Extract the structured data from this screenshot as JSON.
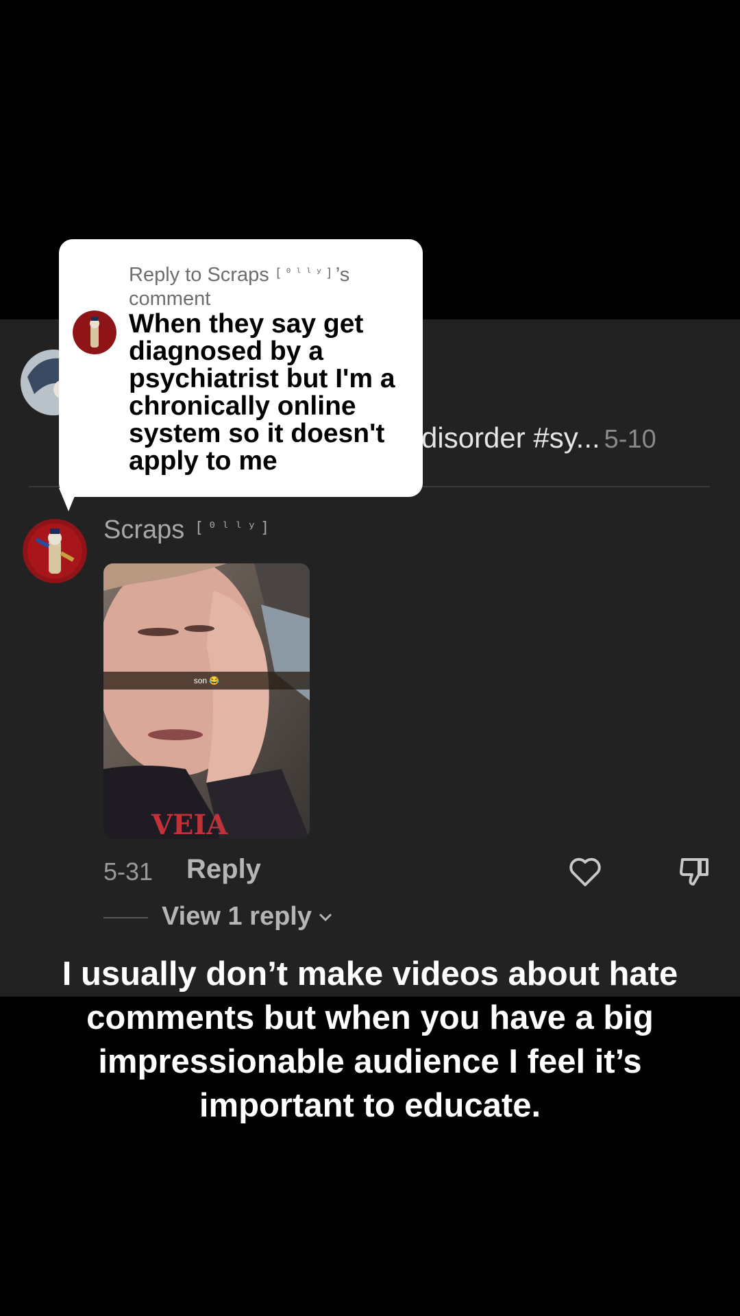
{
  "previous_comment": {
    "text_fragment": "disorder #sy...",
    "date": "5-10"
  },
  "reply_bubble": {
    "reply_to_prefix": "Reply to Scraps ",
    "reply_to_handle": "[⁰ˡˡʸ]",
    "reply_to_suffix": "’s comment",
    "quote": "When they say get diagnosed by a psychiatrist but I'm a chronically online system so it doesn't apply to me"
  },
  "comment": {
    "username": "Scraps ",
    "username_tag": "[⁰ˡˡʸ]",
    "photo_caption": "son 😂",
    "date": "5-31",
    "reply_label": "Reply",
    "view_replies_label": "View 1 reply"
  },
  "caption": "I usually don’t make videos about hate comments but when you have a big impressionable audience I feel it’s important to educate.",
  "colors": {
    "panel": "#222223",
    "background": "#000000",
    "bubble": "#ffffff"
  }
}
